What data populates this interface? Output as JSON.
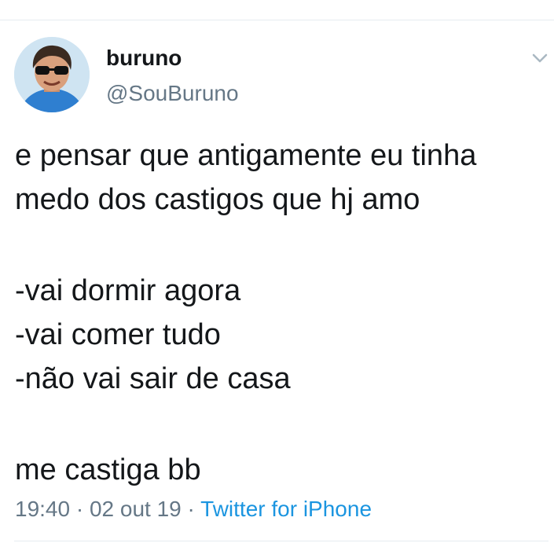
{
  "tweet": {
    "author": {
      "display_name": "buruno",
      "handle": "@SouBuruno",
      "avatar_icon": "user-avatar-photo"
    },
    "text_lines": {
      "line1": "e pensar que antigamente eu tinha\nmedo dos castigos que hj amo",
      "line2": "-vai dormir agora\n-vai comer tudo\n-não vai sair de casa",
      "line3": "me castiga bb"
    },
    "timestamp": {
      "time": "19:40",
      "separator1": " · ",
      "date": "02 out 19",
      "separator2": " · ",
      "source": "Twitter for iPhone"
    },
    "menu_icon": "chevron-down-icon"
  },
  "colors": {
    "text": "#14171a",
    "secondary": "#657786",
    "link": "#1b95e0",
    "divider": "#e6ecf0"
  }
}
